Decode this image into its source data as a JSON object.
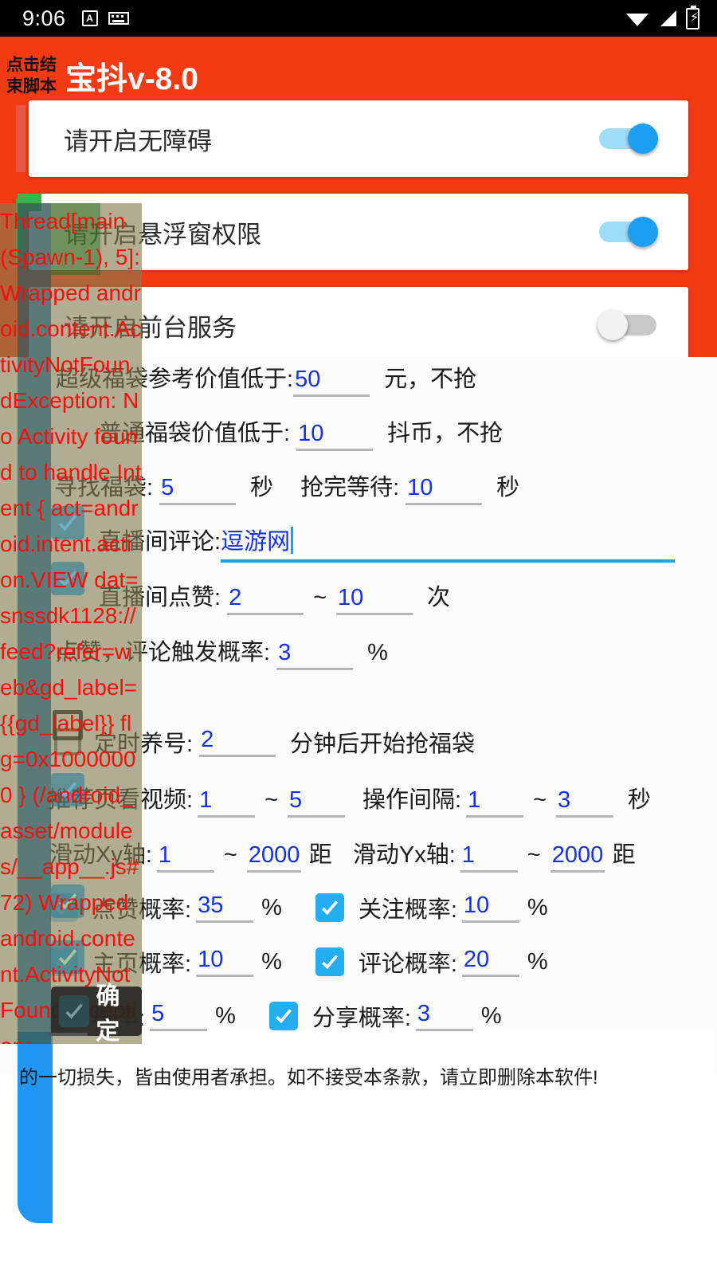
{
  "statusbar": {
    "clock": "9:06",
    "icons": [
      "app-badge-a-icon",
      "keyboard-icon",
      "wifi-icon",
      "cellular-signal-icon",
      "battery-charging-icon"
    ]
  },
  "appbar": {
    "title": "宝抖v-8.0",
    "stop_script_label": "点击结束脚本",
    "accent_color": "#f43a13"
  },
  "permissions": [
    {
      "label": "请开启无障碍",
      "state": "on",
      "accent": "#e8564a"
    },
    {
      "label": "请开启悬浮窗权限",
      "state": "on",
      "accent": "#3ab54a"
    },
    {
      "label": "请开启前台服务",
      "state": "off",
      "accent": "#ffffff"
    }
  ],
  "form": {
    "row_super_lucky": {
      "label": "超级福袋参考价值低于:",
      "value": "50",
      "unit": "元，不抢"
    },
    "row_normal_lucky": {
      "label": "普通福袋价值低于:",
      "value": "10",
      "unit": "抖币，不抢"
    },
    "row_find": {
      "label": "寻找福袋:",
      "value": "5",
      "unit": "秒",
      "label2": "抢完等待:",
      "value2": "10",
      "unit2": "秒"
    },
    "row_comment": {
      "label": "直播间评论:",
      "value": "逗游网"
    },
    "row_like": {
      "label": "直播间点赞:",
      "value_min": "2",
      "value_max": "10",
      "unit": "次"
    },
    "row_comment_prob": {
      "label": "点赞，评论触发概率:",
      "value": "3",
      "unit": "%"
    },
    "row_timer": {
      "label": "定时养号:",
      "value": "2",
      "unit": "分钟后开始抢福袋",
      "checked": false
    },
    "row_recommend": {
      "label": "推荐页看视频:",
      "value_min": "1",
      "value_max": "5",
      "label2": "操作间隔:",
      "value2_min": "1",
      "value2_max": "3",
      "unit2": "秒"
    },
    "row_swipe": {
      "label": "滑动Xy轴:",
      "value_min": "1",
      "value_max": "2000",
      "unit": "距",
      "label2": "滑动Yx轴:",
      "value2_min": "1",
      "value2_max": "2000",
      "unit2": "距"
    },
    "prob_rows": [
      {
        "left_label": "点赞概率:",
        "left_value": "35",
        "right_label": "关注概率:",
        "right_value": "10",
        "right_checked": true,
        "unit": "%"
      },
      {
        "left_label": "主页概率:",
        "left_value": "10",
        "right_label": "评论概率:",
        "right_value": "20",
        "right_checked": true,
        "unit": "%"
      },
      {
        "left_label": "概率:",
        "left_value": "5",
        "right_label": "分享概率:",
        "right_value": "3",
        "right_checked": true,
        "unit": "%"
      }
    ],
    "disclaimer": "的一切损失，皆由使用者承担。如不接受本条款，请立即删除本软件!"
  },
  "log_overlay": {
    "text": "Thread[main (Spawn-1), 5]: Wrapped android.content.ActivityNotFoundException: No Activity found to handle Intent { act=android.intent.action.VIEW dat=snssdk1128://feed?refer=web&gd_label={{gd_label}} flg=0x10000000 } (/android_asset/modules/__app__.js#72) Wrapped android.content.ActivityNotFoundException:",
    "text_color": "#fa0d0d"
  },
  "confirm_toast": {
    "label": "确定"
  }
}
